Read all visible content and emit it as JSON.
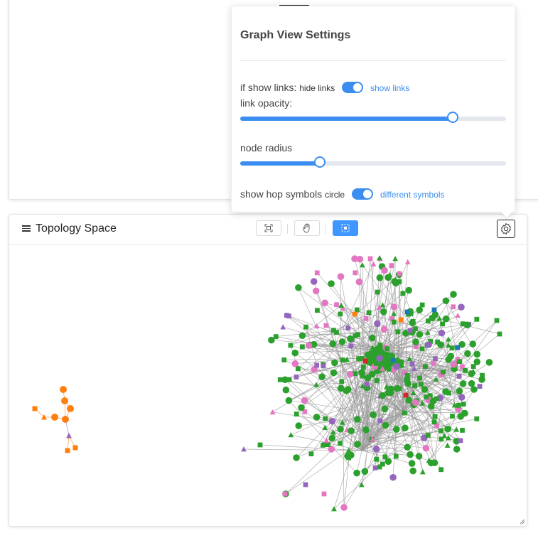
{
  "topology": {
    "title": "Topology Space",
    "tools": [
      "fit-view-icon",
      "pan-hand-icon",
      "box-select-icon"
    ],
    "active_tool": "box-select-icon"
  },
  "settings": {
    "title": "Graph View Settings",
    "show_links": {
      "label": "if show links:",
      "off_label": "hide links",
      "on_label": "show links",
      "enabled": true
    },
    "link_opacity": {
      "label": "link opacity:",
      "value": 0.8
    },
    "node_radius": {
      "label": "node radius",
      "value": 0.3
    },
    "hop_symbols": {
      "label": "show hop symbols",
      "off_label": "circle",
      "on_label": "different symbols",
      "enabled": true
    }
  },
  "colors": {
    "accent": "#3b8ef0",
    "node_green": "#2ca02c",
    "node_orange": "#ff7f0e",
    "node_pink": "#e377c2",
    "node_purple": "#9467bd",
    "node_blue": "#1f77b4",
    "node_red": "#d62728"
  }
}
